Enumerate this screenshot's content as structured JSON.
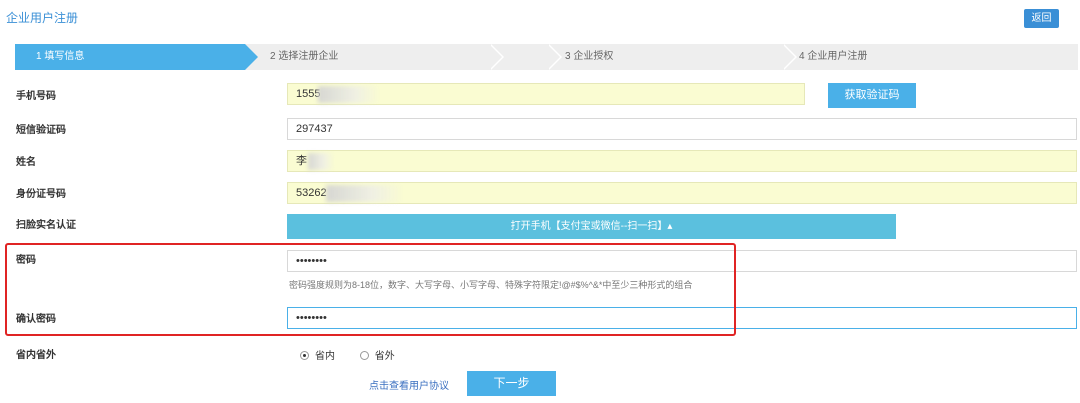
{
  "header": {
    "title": "企业用户注册",
    "back_label": "返回"
  },
  "steps": [
    {
      "label": "1  填写信息",
      "active": true
    },
    {
      "label": "2  选择注册企业",
      "active": false
    },
    {
      "label": "3  企业授权",
      "active": false
    },
    {
      "label": "4  企业用户注册",
      "active": false
    }
  ],
  "form": {
    "phone": {
      "label": "手机号码",
      "value": "1555"
    },
    "get_code_button": "获取验证码",
    "sms_code": {
      "label": "短信验证码",
      "value": "297437"
    },
    "name": {
      "label": "姓名",
      "value": "李"
    },
    "id_number": {
      "label": "身份证号码",
      "value": "53262"
    },
    "face_auth": {
      "label": "扫脸实名认证",
      "button": "打开手机【支付宝或微信--扫一扫】▴"
    },
    "password": {
      "label": "密码",
      "value": "••••••••",
      "hint": "密码强度规则为8-18位，数字、大写字母、小写字母、特殊字符限定!@#$%^&*中至少三种形式的组合"
    },
    "confirm_password": {
      "label": "确认密码",
      "value": "••••••••"
    },
    "region": {
      "label": "省内省外",
      "options": [
        "省内",
        "省外"
      ],
      "selected": "省内"
    }
  },
  "footer": {
    "agreement_link": "点击查看用户协议",
    "next_button": "下一步"
  }
}
